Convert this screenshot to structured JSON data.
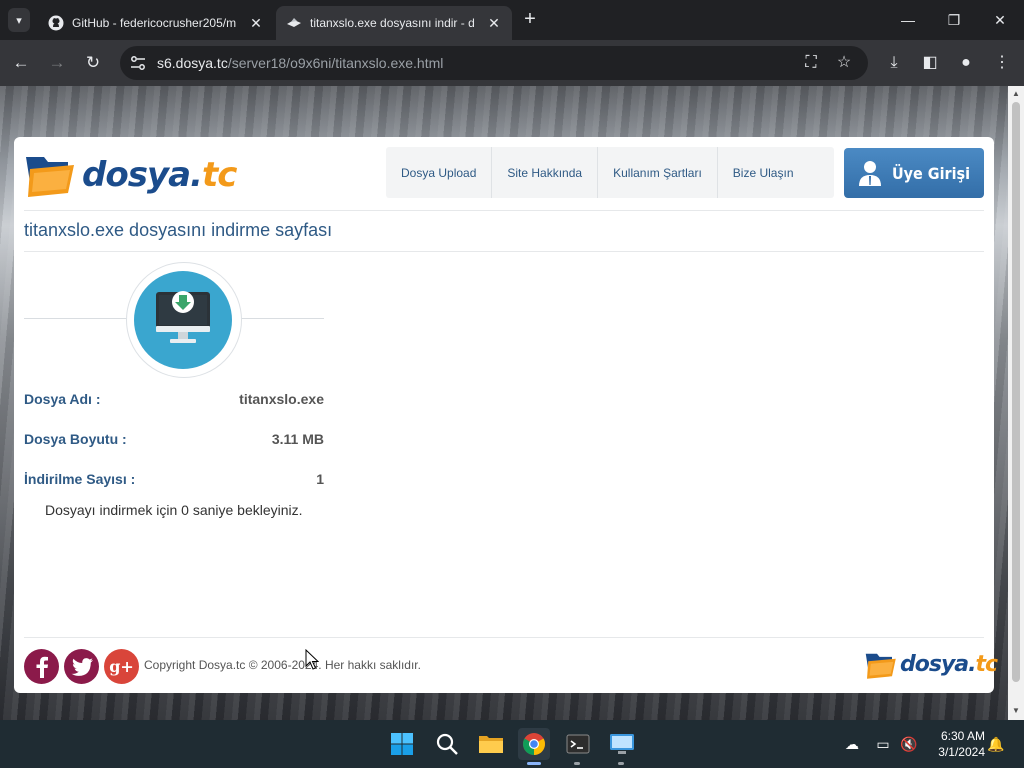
{
  "browser": {
    "tabs": [
      {
        "title": "GitHub - federicocrusher205/m",
        "icon": "github-icon",
        "active": false
      },
      {
        "title": "titanxslo.exe dosyasını indir - d",
        "icon": "dosya-favicon",
        "active": true
      }
    ],
    "new_tab_label": "+",
    "url_host": "s6.dosya.tc",
    "url_path": "/server18/o9x6ni/titanxslo.exe.html"
  },
  "site": {
    "logo_part1": "dosya",
    "logo_dot": ".",
    "logo_part2": "tc",
    "nav": [
      "Dosya Upload",
      "Site Hakkında",
      "Kullanım Şartları",
      "Bize Ulaşın"
    ],
    "login_label": "Üye Girişi",
    "page_title": "titanxslo.exe dosyasını indirme sayfası",
    "file_info": [
      {
        "label": "Dosya Adı :",
        "value": "titanxslo.exe"
      },
      {
        "label": "Dosya Boyutu :",
        "value": "3.11 MB"
      },
      {
        "label": "İndirilme Sayısı :",
        "value": "1"
      }
    ],
    "wait_message": "Dosyayı indirmek için 0 saniye bekleyiniz.",
    "copyright": "Copyright Dosya.tc © 2006-2024. Her hakkı saklıdır.",
    "social": [
      {
        "name": "facebook",
        "glyph": "f",
        "color": "#8b1a4a"
      },
      {
        "name": "twitter",
        "glyph": "t",
        "color": "#8b1a4a"
      },
      {
        "name": "google-plus",
        "glyph": "g+",
        "color": "#d9453a"
      }
    ],
    "colors": {
      "brand_blue": "#1b4c8c",
      "brand_orange": "#f39a1a",
      "accent": "#2f5a85",
      "download_circle": "#3aa6cf"
    }
  },
  "taskbar": {
    "time": "6:30 AM",
    "date": "3/1/2024",
    "apps": [
      "start",
      "search",
      "file-explorer",
      "chrome",
      "terminal",
      "remote-desktop"
    ]
  }
}
